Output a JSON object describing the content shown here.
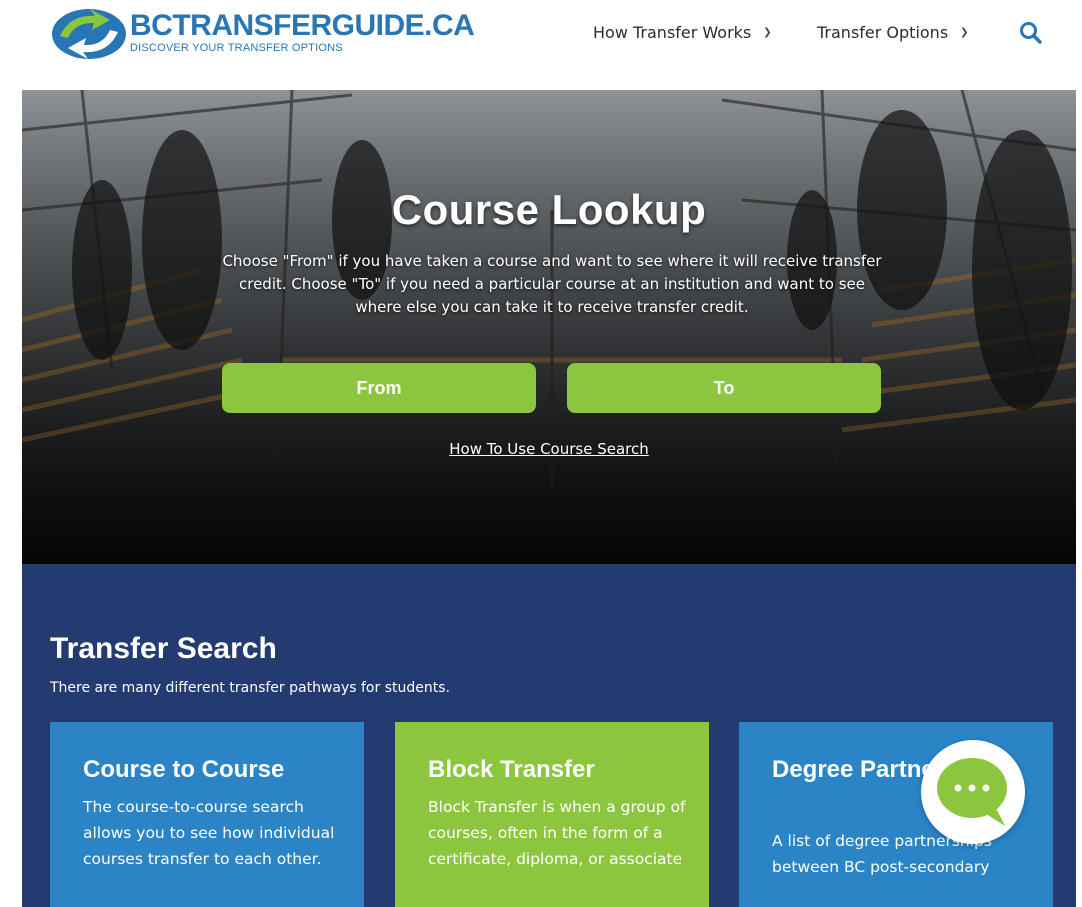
{
  "header": {
    "logo_title": "BCTRANSFERGUIDE.CA",
    "logo_subtitle": "DISCOVER YOUR TRANSFER OPTIONS",
    "nav": [
      {
        "label": "How Transfer Works"
      },
      {
        "label": "Transfer Options"
      }
    ],
    "search_icon": "search-icon"
  },
  "hero": {
    "title": "Course Lookup",
    "description": "Choose \"From\" if you have taken a course and want to see where it will receive transfer credit. Choose \"To\" if you need a particular course at an institution and want to see where else you can take it to receive transfer credit.",
    "from_label": "From",
    "to_label": "To",
    "how_link": "How To Use Course Search"
  },
  "transfer_search": {
    "title": "Transfer Search",
    "description": "There are many different transfer pathways for students.",
    "cards": [
      {
        "title": "Course to Course",
        "text": "The course-to-course search allows you to see how individual courses transfer to each other."
      },
      {
        "title": "Block Transfer",
        "text": "Block Transfer is when a group of courses, often in the form of a certificate, diploma, or associate"
      },
      {
        "title": "Degree Partnerships",
        "text": "A list of degree partnerships between BC post-secondary"
      }
    ]
  },
  "colors": {
    "brand_blue": "#2876b5",
    "green": "#8cc63f",
    "navy": "#243b71",
    "card_blue": "#2a84c6"
  },
  "chat_icon": "chat-bubble-icon"
}
